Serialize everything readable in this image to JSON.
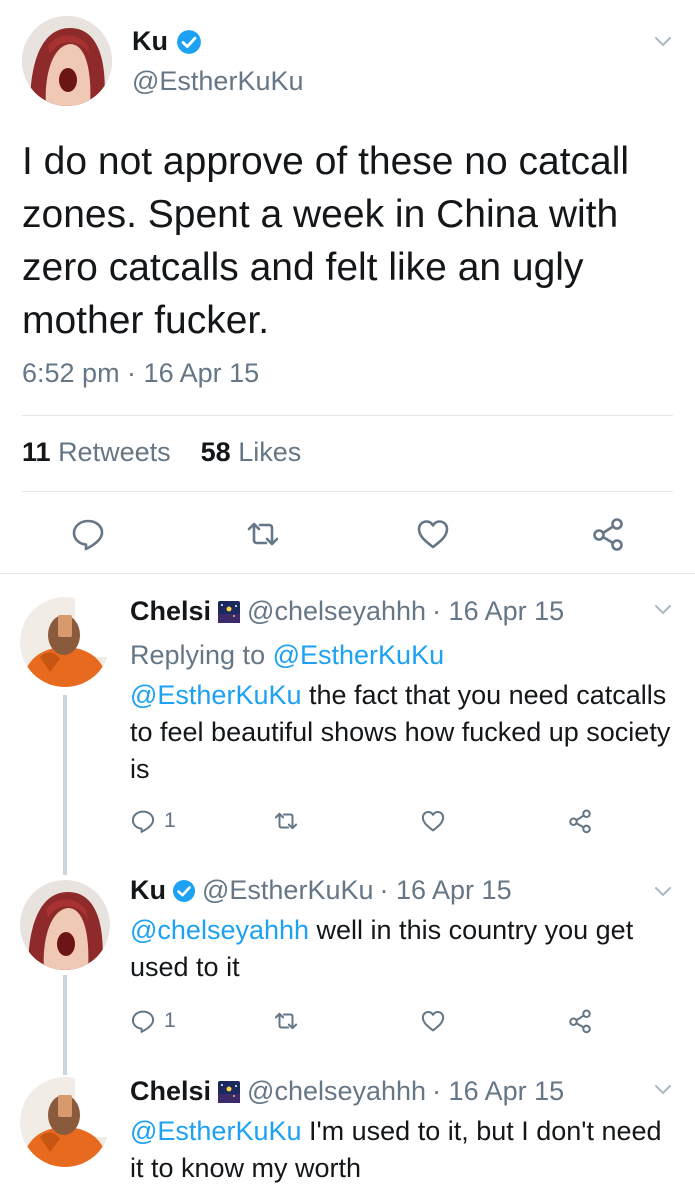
{
  "main_tweet": {
    "name": "Ku",
    "handle": "@EstherKuKu",
    "text": "I do not approve of these no catcall zones. Spent a week in China with zero catcalls and felt like an ugly mother fucker.",
    "timestamp": "6:52 pm · 16 Apr 15",
    "retweets_count": "11",
    "retweets_label": "Retweets",
    "likes_count": "58",
    "likes_label": "Likes",
    "icons": [
      "reply-icon",
      "retweet-icon",
      "like-icon",
      "share-icon"
    ]
  },
  "replies": [
    {
      "name": "Chelsi",
      "handle": "@chelseyahhh",
      "date": "· 16 Apr 15",
      "replying_prefix": "Replying to",
      "replying_handle": "@EstherKuKu",
      "mention": "@EstherKuKu",
      "text": " the fact that you need catcalls to feel beautiful shows how fucked up society is",
      "reply_count": "1"
    },
    {
      "name": "Ku",
      "handle": "@EstherKuKu",
      "date": "· 16 Apr 15",
      "mention": "@chelseyahhh",
      "text": " well in this country you get used to it",
      "reply_count": "1"
    },
    {
      "name": "Chelsi",
      "handle": "@chelseyahhh",
      "date": "· 16 Apr 15",
      "mention": "@EstherKuKu",
      "text": " I'm used to it, but I don't need it to know my worth"
    }
  ],
  "colors": {
    "accent": "#1da1f2",
    "muted": "#657786",
    "divider": "#e1e8ed",
    "thread_line": "#ccd6dd"
  }
}
